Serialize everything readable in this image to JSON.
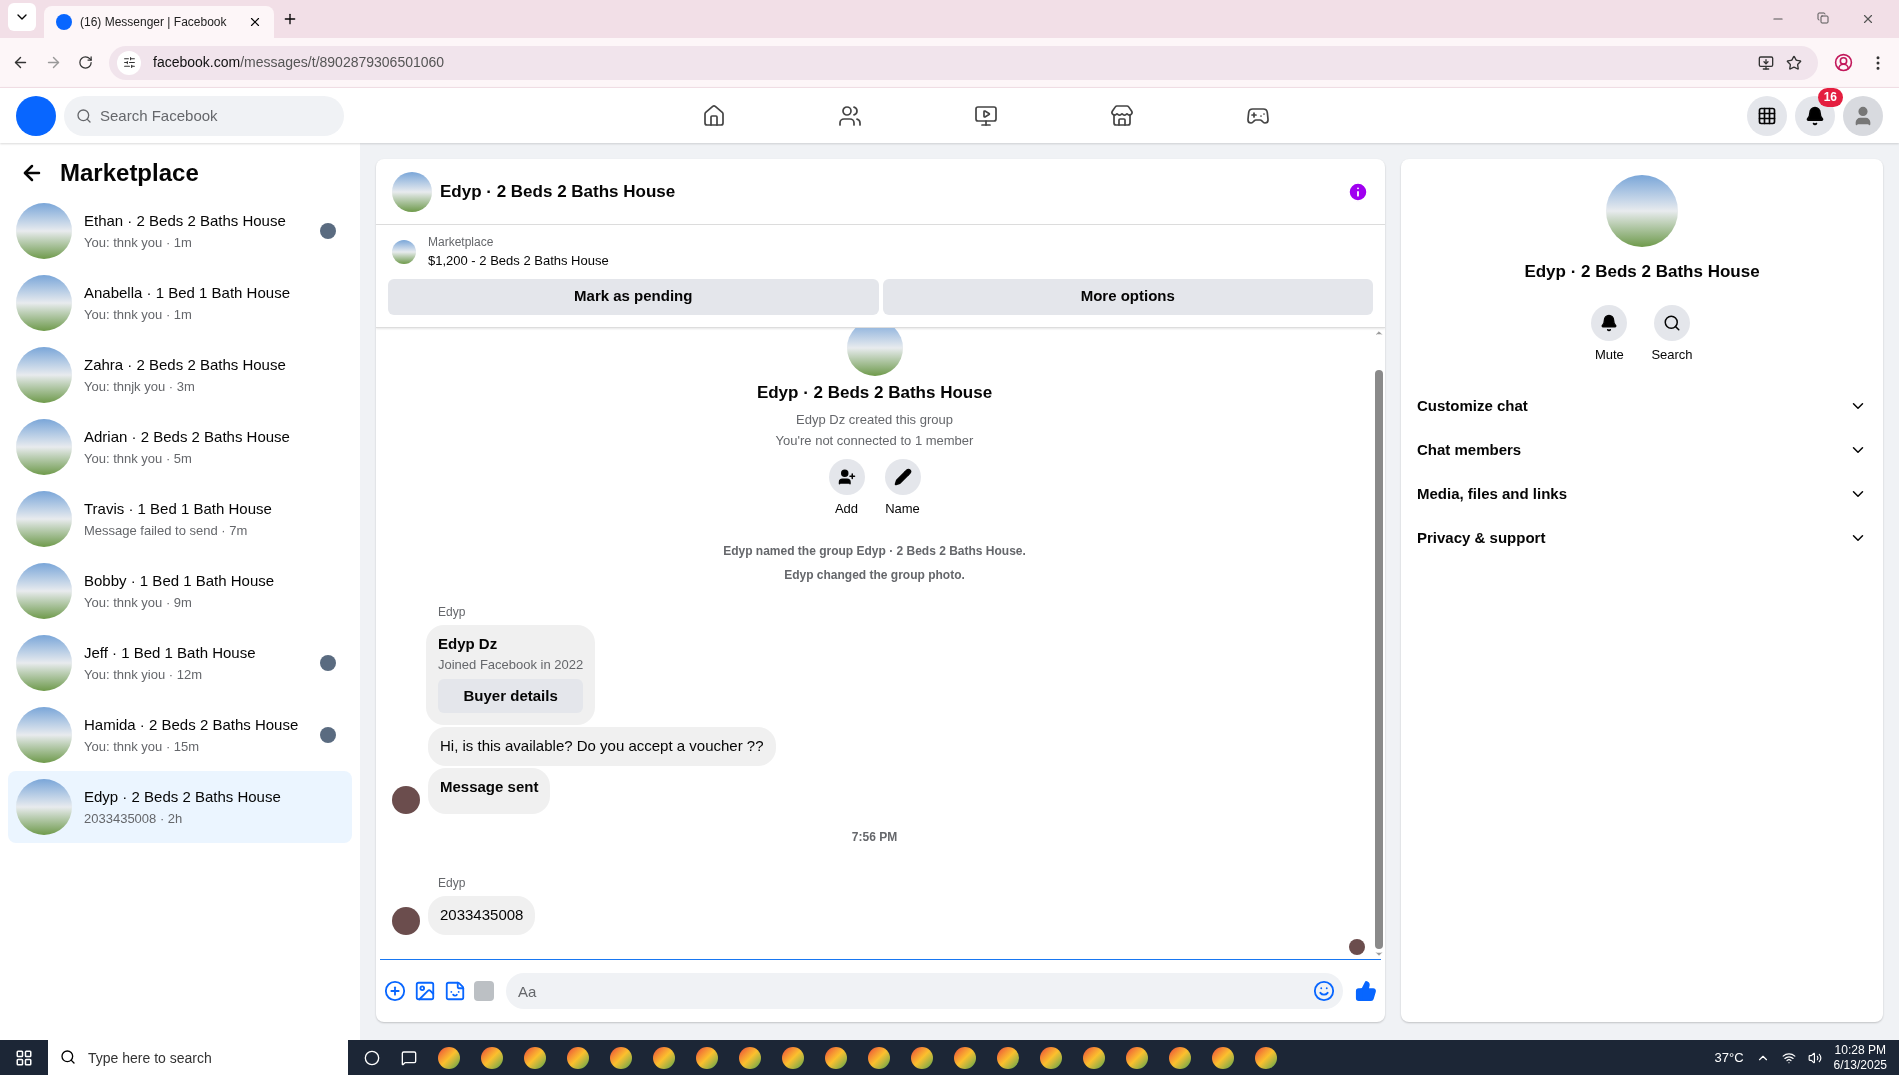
{
  "browser": {
    "tab_title": "(16) Messenger | Facebook",
    "url_host": "facebook.com",
    "url_path": "/messages/t/8902879306501060"
  },
  "header": {
    "search_placeholder": "Search Facebook",
    "notification_count": "16"
  },
  "sidebar": {
    "title": "Marketplace",
    "conversations": [
      {
        "title": "Ethan · 2 Beds 2 Baths House",
        "preview": "You: thnk you · 1m",
        "seen": true,
        "selected": false
      },
      {
        "title": "Anabella · 1 Bed 1 Bath House",
        "preview": "You: thnk you · 1m",
        "seen": false,
        "selected": false
      },
      {
        "title": "Zahra · 2 Beds 2 Baths House",
        "preview": "You: thnjk you · 3m",
        "seen": false,
        "selected": false
      },
      {
        "title": "Adrian · 2 Beds 2 Baths House",
        "preview": "You: thnk you · 5m",
        "seen": false,
        "selected": false
      },
      {
        "title": "Travis · 1 Bed 1 Bath House",
        "preview": "Message failed to send · 7m",
        "seen": false,
        "selected": false
      },
      {
        "title": "Bobby · 1 Bed 1 Bath House",
        "preview": "You: thnk you · 9m",
        "seen": false,
        "selected": false
      },
      {
        "title": "Jeff · 1 Bed 1 Bath House",
        "preview": "You: thnk yiou · 12m",
        "seen": true,
        "selected": false
      },
      {
        "title": "Hamida · 2 Beds 2 Baths House",
        "preview": "You: thnk you · 15m",
        "seen": true,
        "selected": false
      },
      {
        "title": "Edyp · 2 Beds 2 Baths House",
        "preview": "2033435008 · 2h",
        "seen": false,
        "selected": true
      }
    ]
  },
  "chat": {
    "title": "Edyp · 2 Beds 2 Baths House",
    "listing": {
      "label": "Marketplace",
      "price": "$1,200 - 2 Beds 2 Baths House",
      "buttons": [
        "Mark as pending",
        "More options"
      ]
    },
    "intro": {
      "title": "Edyp · 2 Beds 2 Baths House",
      "lines": [
        "Edyp Dz created this group",
        "You're not connected to 1 member"
      ],
      "actions": [
        {
          "kind": "add",
          "label": "Add"
        },
        {
          "kind": "name",
          "label": "Name"
        }
      ]
    },
    "items": [
      {
        "kind": "event",
        "text": "Edyp named the group Edyp · 2 Beds 2 Baths House."
      },
      {
        "kind": "event",
        "text": "Edyp changed the group photo."
      },
      {
        "kind": "sender",
        "text": "Edyp"
      },
      {
        "kind": "card",
        "name": "Edyp Dz",
        "sub": "Joined Facebook in 2022",
        "button": "Buyer details"
      },
      {
        "kind": "bubble",
        "text": "Hi, is this available? Do you accept a voucher ??",
        "bold": false,
        "avatar": false
      },
      {
        "kind": "bubble",
        "text": "Message sent",
        "bold": true,
        "avatar": true
      },
      {
        "kind": "time",
        "text": "7:56 PM"
      },
      {
        "kind": "sender",
        "text": "Edyp"
      },
      {
        "kind": "bubble",
        "text": "2033435008",
        "bold": false,
        "avatar": true
      }
    ],
    "composer_placeholder": "Aa"
  },
  "details": {
    "title": "Edyp · 2 Beds 2 Baths House",
    "actions": [
      {
        "kind": "mute",
        "label": "Mute"
      },
      {
        "kind": "search",
        "label": "Search"
      }
    ],
    "sections": [
      {
        "label": "Customize chat",
        "expanded": false
      },
      {
        "label": "Chat members",
        "expanded": false
      },
      {
        "label": "Media, files and links",
        "expanded": false
      },
      {
        "label": "Privacy & support",
        "expanded": false
      }
    ]
  },
  "taskbar": {
    "search_placeholder": "Type here to search",
    "temperature": "37°C",
    "time": "10:28 PM",
    "date": "6/13/2025"
  }
}
